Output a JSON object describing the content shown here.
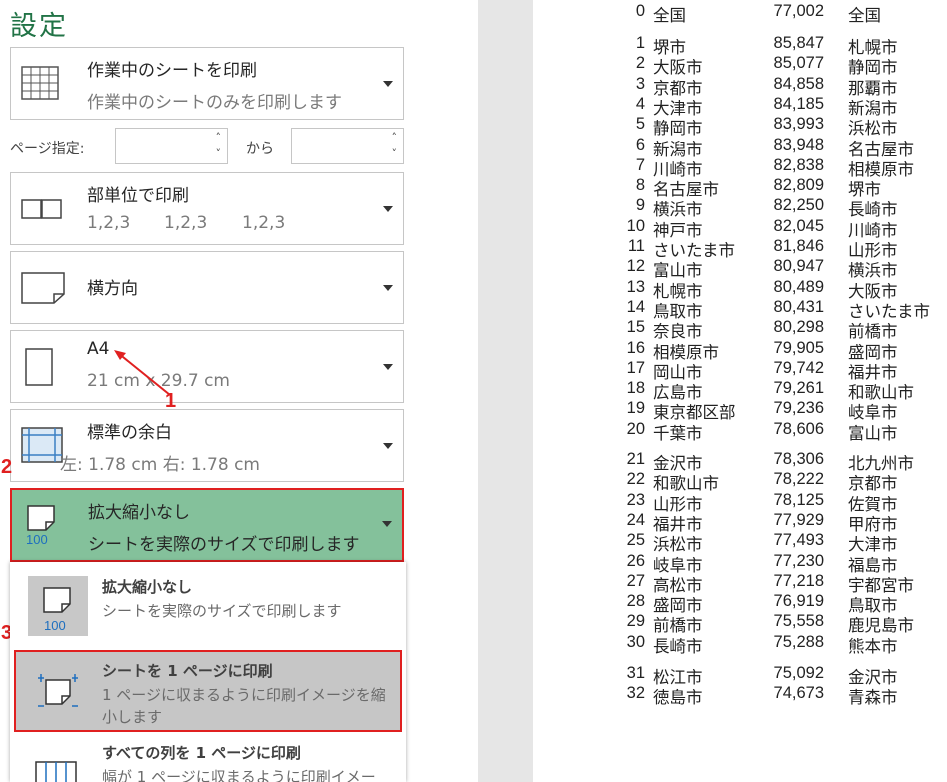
{
  "settings": {
    "title": "設定",
    "sheet_scope": {
      "label": "作業中のシートを印刷",
      "desc": "作業中のシートのみを印刷します"
    },
    "pages": {
      "label": "ページ指定:",
      "from_value": "",
      "to_label": "から",
      "to_value": ""
    },
    "collate": {
      "label": "部単位で印刷",
      "desc1": "1,2,3",
      "desc2": "1,2,3",
      "desc3": "1,2,3"
    },
    "orientation": {
      "label": "横方向"
    },
    "paper": {
      "label": "A4",
      "desc": "21 cm x 29.7 cm"
    },
    "margins": {
      "label": "標準の余白",
      "desc": "左:  1.78 cm     右:  1.78 cm"
    },
    "scaling": {
      "label": "拡大縮小なし",
      "desc": "シートを実際のサイズで印刷します",
      "icon_text": "100"
    }
  },
  "annotations": {
    "badge1": "1",
    "badge2": "2",
    "badge3": "3"
  },
  "scaling_menu": {
    "items": [
      {
        "title": "拡大縮小なし",
        "desc": "シートを実際のサイズで印刷します",
        "icon_text": "100"
      },
      {
        "title": "シートを 1 ページに印刷",
        "desc": "1 ページに収まるように印刷イメージを縮小します"
      },
      {
        "title": "すべての列を 1 ページに印刷",
        "desc": "幅が 1 ページに収まるように印刷イメー"
      }
    ]
  },
  "preview": {
    "header": {
      "rank": "0",
      "city": "全国",
      "value": "77,002",
      "city2": "全国"
    },
    "rows": [
      {
        "rank": "1",
        "city": "堺市",
        "value": "85,847",
        "city2": "札幌市"
      },
      {
        "rank": "2",
        "city": "大阪市",
        "value": "85,077",
        "city2": "静岡市"
      },
      {
        "rank": "3",
        "city": "京都市",
        "value": "84,858",
        "city2": "那覇市"
      },
      {
        "rank": "4",
        "city": "大津市",
        "value": "84,185",
        "city2": "新潟市"
      },
      {
        "rank": "5",
        "city": "静岡市",
        "value": "83,993",
        "city2": "浜松市"
      },
      {
        "rank": "6",
        "city": "新潟市",
        "value": "83,948",
        "city2": "名古屋市"
      },
      {
        "rank": "7",
        "city": "川崎市",
        "value": "82,838",
        "city2": "相模原市"
      },
      {
        "rank": "8",
        "city": "名古屋市",
        "value": "82,809",
        "city2": "堺市"
      },
      {
        "rank": "9",
        "city": "横浜市",
        "value": "82,250",
        "city2": "長崎市"
      },
      {
        "rank": "10",
        "city": "神戸市",
        "value": "82,045",
        "city2": "川崎市"
      },
      {
        "rank": "11",
        "city": "さいたま市",
        "value": "81,846",
        "city2": "山形市"
      },
      {
        "rank": "12",
        "city": "富山市",
        "value": "80,947",
        "city2": "横浜市"
      },
      {
        "rank": "13",
        "city": "札幌市",
        "value": "80,489",
        "city2": "大阪市"
      },
      {
        "rank": "14",
        "city": "鳥取市",
        "value": "80,431",
        "city2": "さいたま市"
      },
      {
        "rank": "15",
        "city": "奈良市",
        "value": "80,298",
        "city2": "前橋市"
      },
      {
        "rank": "16",
        "city": "相模原市",
        "value": "79,905",
        "city2": "盛岡市"
      },
      {
        "rank": "17",
        "city": "岡山市",
        "value": "79,742",
        "city2": "福井市"
      },
      {
        "rank": "18",
        "city": "広島市",
        "value": "79,261",
        "city2": "和歌山市"
      },
      {
        "rank": "19",
        "city": "東京都区部",
        "value": "79,236",
        "city2": "岐阜市"
      },
      {
        "rank": "20",
        "city": "千葉市",
        "value": "78,606",
        "city2": "富山市"
      },
      {
        "rank": "21",
        "city": "金沢市",
        "value": "78,306",
        "city2": "北九州市"
      },
      {
        "rank": "22",
        "city": "和歌山市",
        "value": "78,222",
        "city2": "京都市"
      },
      {
        "rank": "23",
        "city": "山形市",
        "value": "78,125",
        "city2": "佐賀市"
      },
      {
        "rank": "24",
        "city": "福井市",
        "value": "77,929",
        "city2": "甲府市"
      },
      {
        "rank": "25",
        "city": "浜松市",
        "value": "77,493",
        "city2": "大津市"
      },
      {
        "rank": "26",
        "city": "岐阜市",
        "value": "77,230",
        "city2": "福島市"
      },
      {
        "rank": "27",
        "city": "高松市",
        "value": "77,218",
        "city2": "宇都宮市"
      },
      {
        "rank": "28",
        "city": "盛岡市",
        "value": "76,919",
        "city2": "鳥取市"
      },
      {
        "rank": "29",
        "city": "前橋市",
        "value": "75,558",
        "city2": "鹿児島市"
      },
      {
        "rank": "30",
        "city": "長崎市",
        "value": "75,288",
        "city2": "熊本市"
      },
      {
        "rank": "31",
        "city": "松江市",
        "value": "75,092",
        "city2": "金沢市"
      },
      {
        "rank": "32",
        "city": "徳島市",
        "value": "74,673",
        "city2": "青森市"
      }
    ]
  },
  "colors": {
    "accent_green": "#84c19b",
    "highlight_border": "#e02020",
    "badge": "#e02020",
    "menu_selected": "#c6c6c6",
    "title_green": "#217346"
  }
}
